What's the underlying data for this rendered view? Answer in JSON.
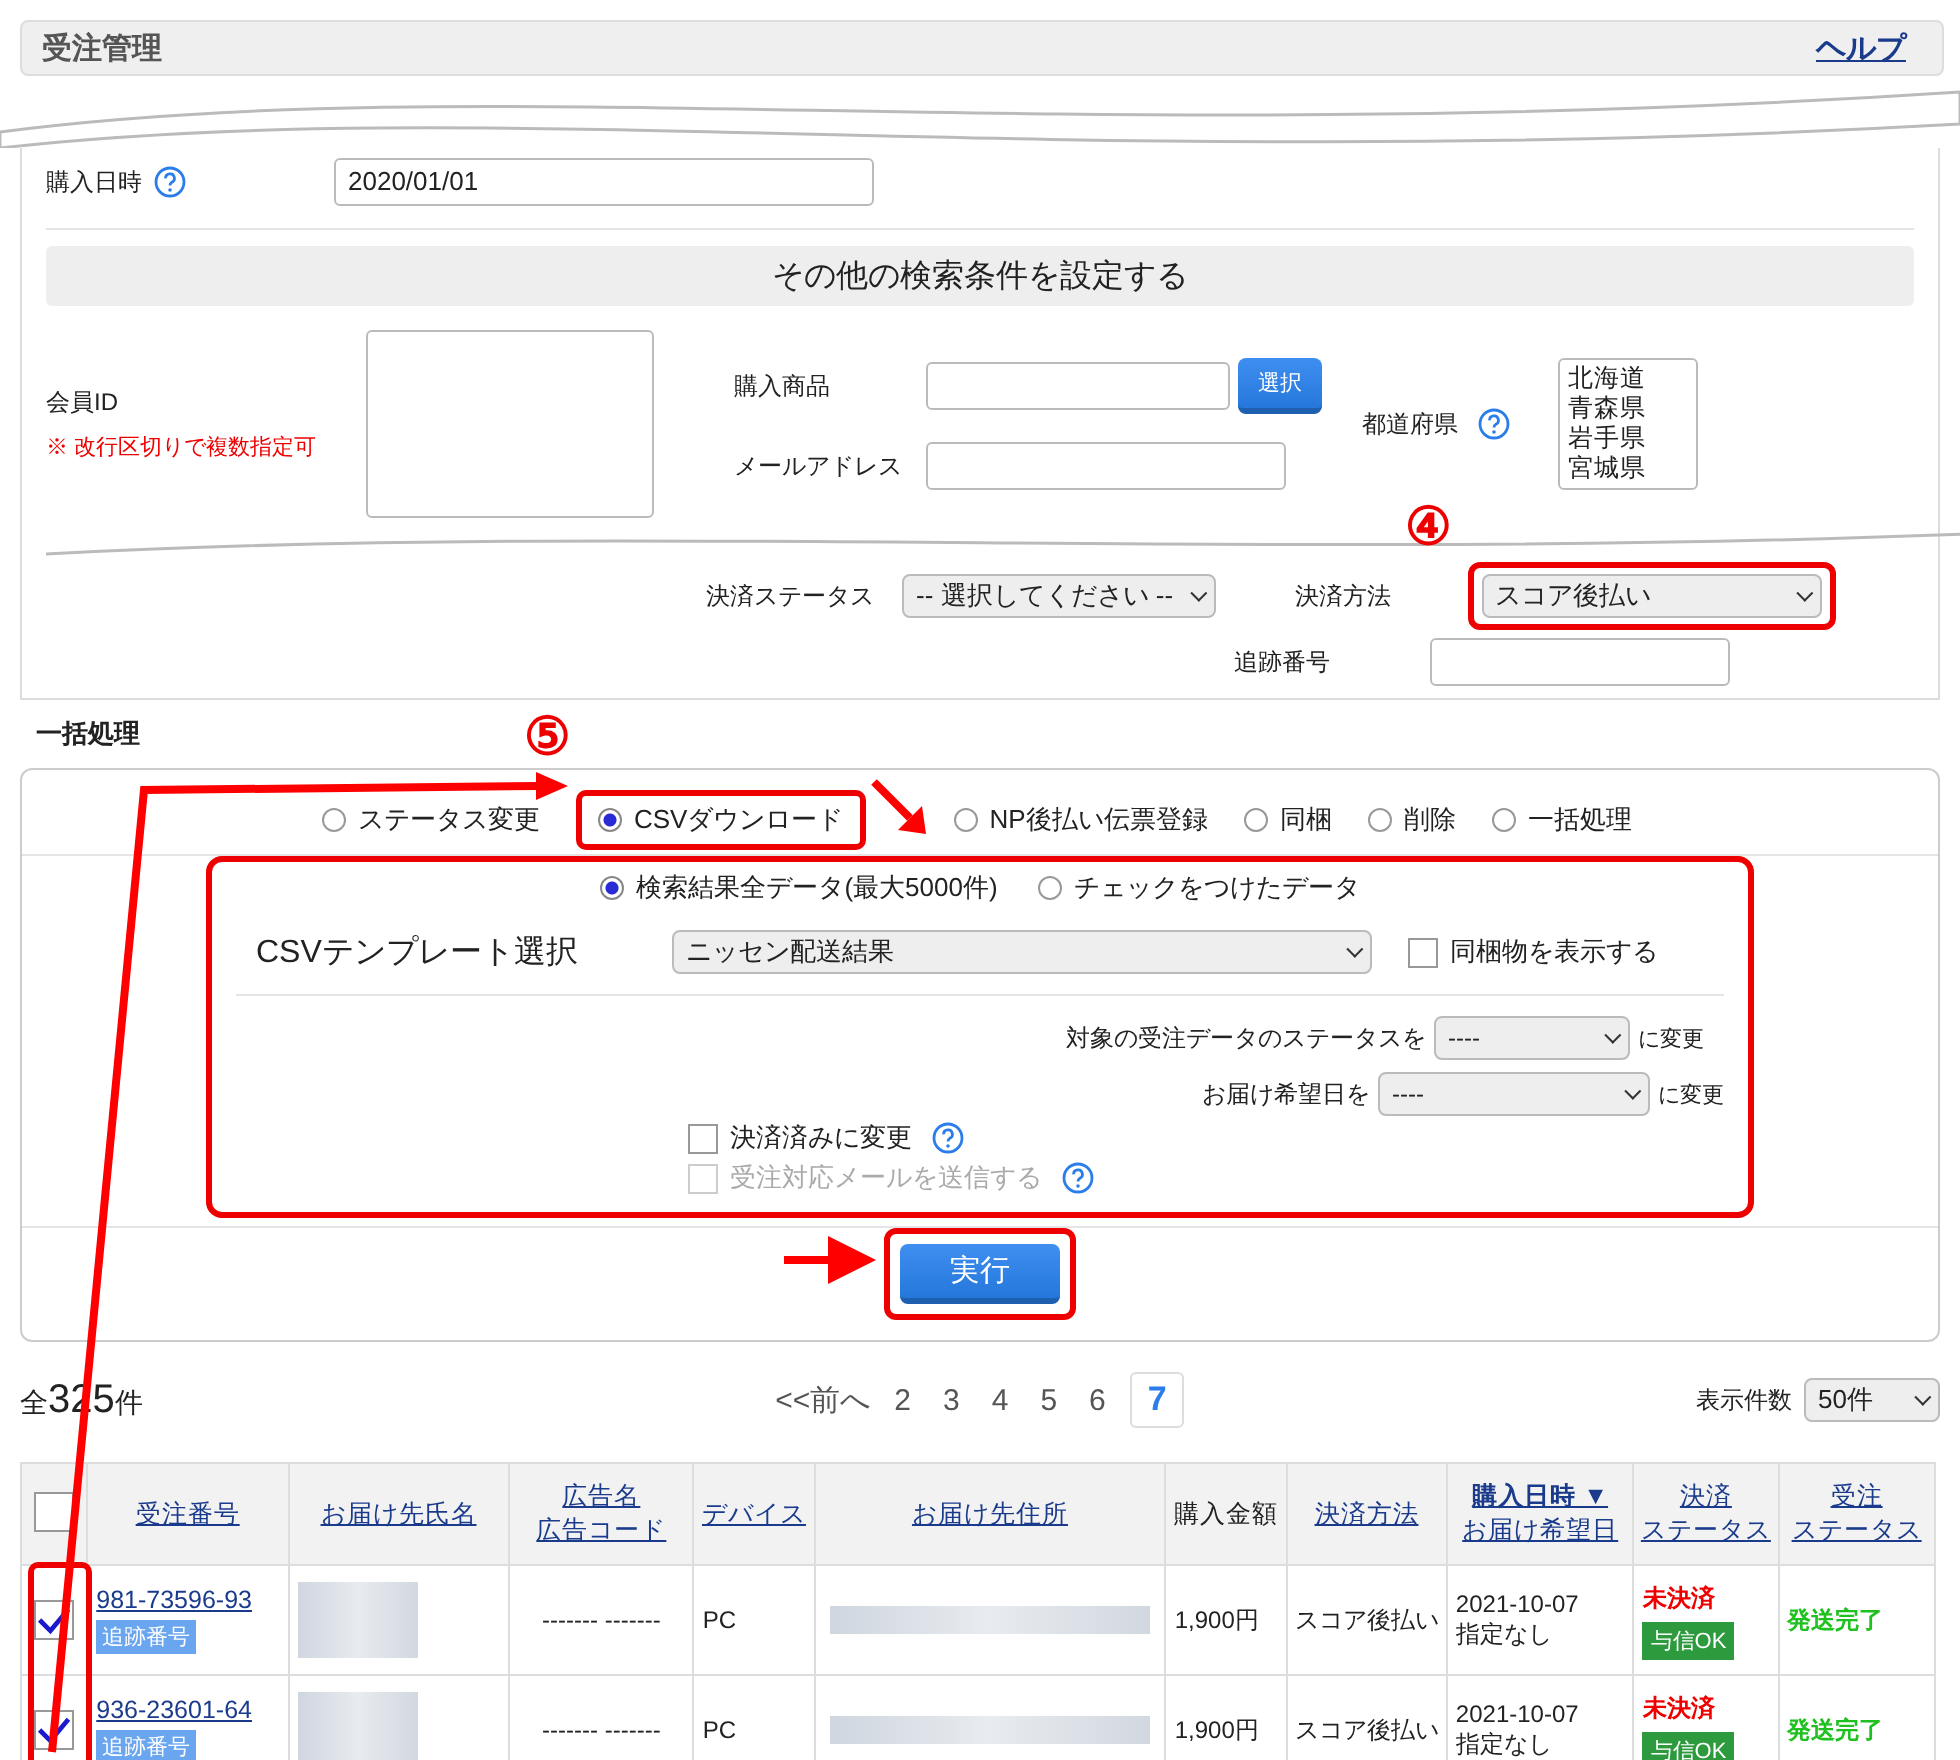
{
  "header": {
    "title": "受注管理",
    "help_link": "ヘルプ"
  },
  "search": {
    "date_label": "購入日時",
    "date_value": "2020/01/01",
    "other_conditions": "その他の検索条件を設定する",
    "member_id_label": "会員ID",
    "member_id_note": "※ 改行区切りで複数指定可",
    "product_label": "購入商品",
    "select_button": "選択",
    "email_label": "メールアドレス",
    "prefecture_label": "都道府県",
    "prefectures": [
      "北海道",
      "青森県",
      "岩手県",
      "宮城県"
    ],
    "payment_status_label": "決済ステータス",
    "payment_status_value": "-- 選択してください --",
    "payment_method_label": "決済方法",
    "payment_method_value": "スコア後払い",
    "tracking_label": "追跡番号"
  },
  "annotations": {
    "payment_method_marker": "④",
    "csv_marker": "⑤"
  },
  "bulk": {
    "heading": "一括処理",
    "actions": [
      {
        "label": "ステータス変更",
        "selected": false
      },
      {
        "label": "CSVダウンロード",
        "selected": true
      },
      {
        "label": "NP後払い伝票登録",
        "selected": false
      },
      {
        "label": "同梱",
        "selected": false
      },
      {
        "label": "削除",
        "selected": false
      },
      {
        "label": "一括処理",
        "selected": false
      }
    ],
    "targets": [
      {
        "label": "検索結果全データ(最大5000件)",
        "selected": true
      },
      {
        "label": "チェックをつけたデータ",
        "selected": false
      }
    ],
    "template_label": "CSVテンプレート選択",
    "template_value": "ニッセン配送結果",
    "bundle_checkbox": {
      "label": "同梱物を表示する",
      "checked": false
    },
    "status_change": {
      "label": "対象の受注データのステータスを",
      "value": "----",
      "suffix": "に変更"
    },
    "delivery_change": {
      "label": "お届け希望日を",
      "value": "----",
      "suffix": "に変更"
    },
    "options": [
      {
        "label": "決済済みに変更",
        "checked": false,
        "disabled": false
      },
      {
        "label": "受注対応メールを送信する",
        "checked": false,
        "disabled": true
      }
    ],
    "run_button": "実行"
  },
  "results": {
    "total_prefix": "全",
    "total_count": "325",
    "total_suffix": "件",
    "prev": "<<前へ",
    "pages": [
      {
        "label": "2",
        "selected": false
      },
      {
        "label": "3",
        "selected": false
      },
      {
        "label": "4",
        "selected": false
      },
      {
        "label": "5",
        "selected": false
      },
      {
        "label": "6",
        "selected": false
      },
      {
        "label": "7",
        "selected": true
      }
    ],
    "per_page_label": "表示件数",
    "per_page_value": "50件"
  },
  "table": {
    "select_all": {
      "checked": false
    },
    "columns": [
      {
        "lines": [
          "受注番号"
        ],
        "link": true,
        "sorted": false
      },
      {
        "lines": [
          "お届け先氏名"
        ],
        "link": true,
        "sorted": false
      },
      {
        "lines": [
          "広告名",
          "広告コード"
        ],
        "link": true,
        "sorted": false
      },
      {
        "lines": [
          "デバイス"
        ],
        "link": true,
        "sorted": false
      },
      {
        "lines": [
          "お届け先住所"
        ],
        "link": true,
        "sorted": false
      },
      {
        "lines": [
          "購入金額"
        ],
        "link": false,
        "sorted": false
      },
      {
        "lines": [
          "決済方法"
        ],
        "link": true,
        "sorted": false
      },
      {
        "lines": [
          "購入日時 ▼",
          "お届け希望日"
        ],
        "link": true,
        "sorted": true
      },
      {
        "lines": [
          "決済",
          "ステータス"
        ],
        "link": true,
        "sorted": false
      },
      {
        "lines": [
          "受注",
          "ステータス"
        ],
        "link": true,
        "sorted": false
      }
    ],
    "rows": [
      {
        "checked": true,
        "order_no": "981-73596-93",
        "tracking": "追跡番号",
        "ad": "------- -------",
        "device": "PC",
        "amount": "1,900円",
        "method": "スコア後払い",
        "date": "2021-10-07",
        "desired": "指定なし",
        "payment_status": "未決済",
        "credit": "与信OK",
        "order_status": "発送完了"
      },
      {
        "checked": true,
        "order_no": "936-23601-64",
        "tracking": "追跡番号",
        "ad": "------- -------",
        "device": "PC",
        "amount": "1,900円",
        "method": "スコア後払い",
        "date": "2021-10-07",
        "desired": "指定なし",
        "payment_status": "未決済",
        "credit": "与信OK",
        "order_status": "発送完了"
      }
    ]
  }
}
